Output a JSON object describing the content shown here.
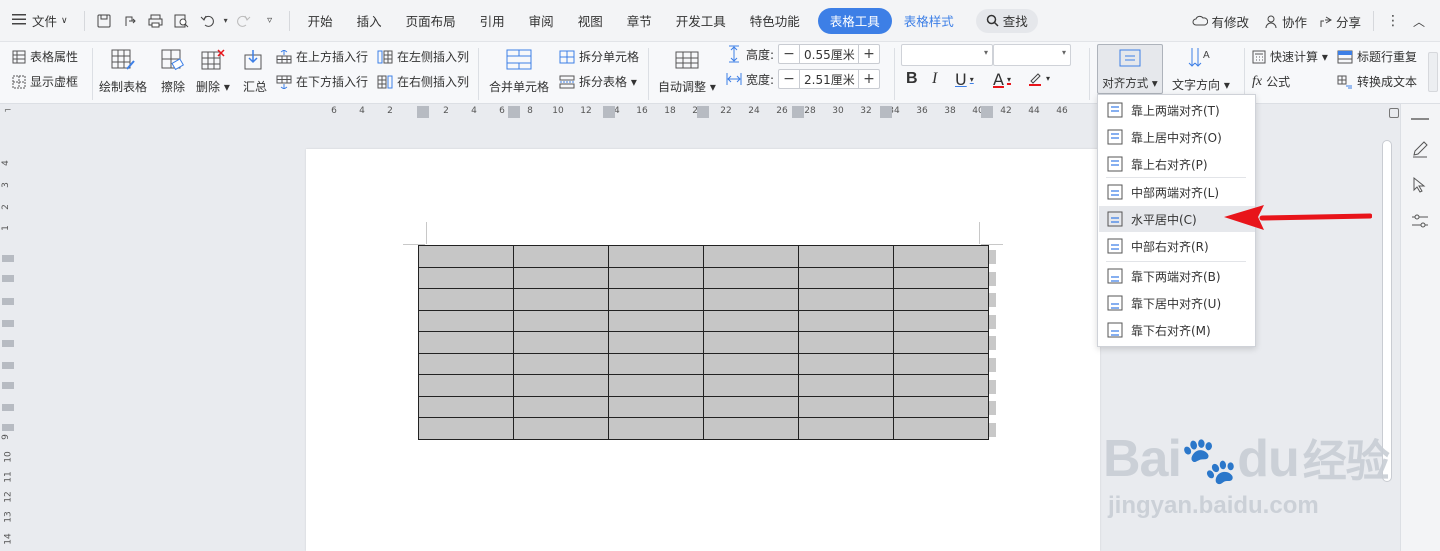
{
  "menubar": {
    "file_label": "文件",
    "tabs": [
      "开始",
      "插入",
      "页面布局",
      "引用",
      "审阅",
      "视图",
      "章节",
      "开发工具",
      "特色功能"
    ],
    "context_tab_active": "表格工具",
    "context_tab_style": "表格样式",
    "search_label": "查找",
    "modified_label": "有修改",
    "collab_label": "协作",
    "share_label": "分享"
  },
  "ribbon": {
    "table_props": "表格属性",
    "show_gridlines": "显示虚框",
    "draw_table": "绘制表格",
    "erase": "擦除",
    "delete": "删除",
    "summary": "汇总",
    "insert_row_above": "在上方插入行",
    "insert_row_below": "在下方插入行",
    "insert_col_left": "在左侧插入列",
    "insert_col_right": "在右侧插入列",
    "merge_cells": "合并单元格",
    "split_cells": "拆分单元格",
    "split_table": "拆分表格",
    "auto_fit": "自动调整",
    "height_label": "高度:",
    "height_value": "0.55厘米",
    "width_label": "宽度:",
    "width_value": "2.51厘米",
    "align_label": "对齐方式",
    "text_direction": "文字方向",
    "quick_calc": "快速计算",
    "repeat_header": "标题行重复",
    "formula": "公式",
    "convert_text": "转换成文本"
  },
  "ruler": {
    "h_numbers": [
      "6",
      "4",
      "2",
      "2",
      "4",
      "6",
      "8",
      "10",
      "12",
      "14",
      "16",
      "18",
      "20",
      "22",
      "24",
      "26",
      "28",
      "30",
      "32",
      "34",
      "36",
      "38",
      "40",
      "42",
      "44",
      "46"
    ],
    "v_numbers": [
      "4",
      "3",
      "2",
      "1",
      "9",
      "10",
      "11",
      "12",
      "13",
      "14"
    ]
  },
  "align_menu": {
    "items": [
      {
        "label": "靠上两端对齐(T)",
        "hover": false
      },
      {
        "label": "靠上居中对齐(O)",
        "hover": false
      },
      {
        "label": "靠上右对齐(P)",
        "hover": false
      },
      {
        "label": "中部两端对齐(L)",
        "hover": false
      },
      {
        "label": "水平居中(C)",
        "hover": true
      },
      {
        "label": "中部右对齐(R)",
        "hover": false
      },
      {
        "label": "靠下两端对齐(B)",
        "hover": false
      },
      {
        "label": "靠下居中对齐(U)",
        "hover": false
      },
      {
        "label": "靠下右对齐(M)",
        "hover": false
      }
    ]
  },
  "document": {
    "table_rows": 9,
    "table_cols": 6
  },
  "watermark": {
    "brand_main": "Bai",
    "brand_mid": "du",
    "brand_cn": "经验",
    "url": "jingyan.baidu.com"
  },
  "colors": {
    "accent": "#3d7fe6",
    "arrow": "#e8141a",
    "cell_fill": "#c6c6c6"
  }
}
